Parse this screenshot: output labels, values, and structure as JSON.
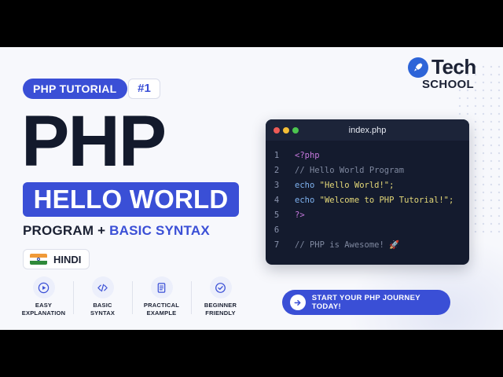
{
  "brand": {
    "name": "Tech",
    "sub": "SCHOOL",
    "color": "#2d64d8"
  },
  "header": {
    "tutorial_pill": "PHP TUTORIAL",
    "episode": "#1"
  },
  "hero": {
    "title": "PHP",
    "highlight": "HELLO WORLD",
    "subtitle_part1": "PROGRAM + ",
    "subtitle_part2": "BASIC SYNTAX"
  },
  "language": {
    "label": "HINDI",
    "icon": "india-flag-icon"
  },
  "features": [
    {
      "icon": "play-icon",
      "label": "EASY\nEXPLANATION"
    },
    {
      "icon": "code-icon",
      "label": "BASIC\nSYNTAX"
    },
    {
      "icon": "document-icon",
      "label": "PRACTICAL\nEXAMPLE"
    },
    {
      "icon": "check-badge-icon",
      "label": "BEGINNER\nFRIENDLY"
    }
  ],
  "code_window": {
    "filename": "index.php",
    "lines": [
      {
        "n": "1",
        "text": "<?php",
        "color": "#c678dd"
      },
      {
        "n": "2",
        "text": "// Hello World Program",
        "color": "#7f889f"
      },
      {
        "n": "3",
        "text": "echo \"Hello World!\";",
        "color": "#e4d878"
      },
      {
        "n": "4",
        "text": "echo \"Welcome to PHP Tutorial!\";",
        "color": "#e4d878"
      },
      {
        "n": "5",
        "text": "?>",
        "color": "#c678dd"
      },
      {
        "n": "6",
        "text": "",
        "color": "#7f889f"
      },
      {
        "n": "7",
        "text": "// PHP is Awesome! 🚀",
        "color": "#7f889f"
      }
    ]
  },
  "cta": {
    "label": "START YOUR PHP JOURNEY TODAY!",
    "icon": "arrow-right-icon"
  },
  "colors": {
    "accent": "#3a4fd6",
    "dark": "#131a2c",
    "echo_keyword": "#7fb2f0",
    "dot_red": "#ee5b56",
    "dot_yellow": "#f4be36",
    "dot_green": "#4cc44f"
  }
}
